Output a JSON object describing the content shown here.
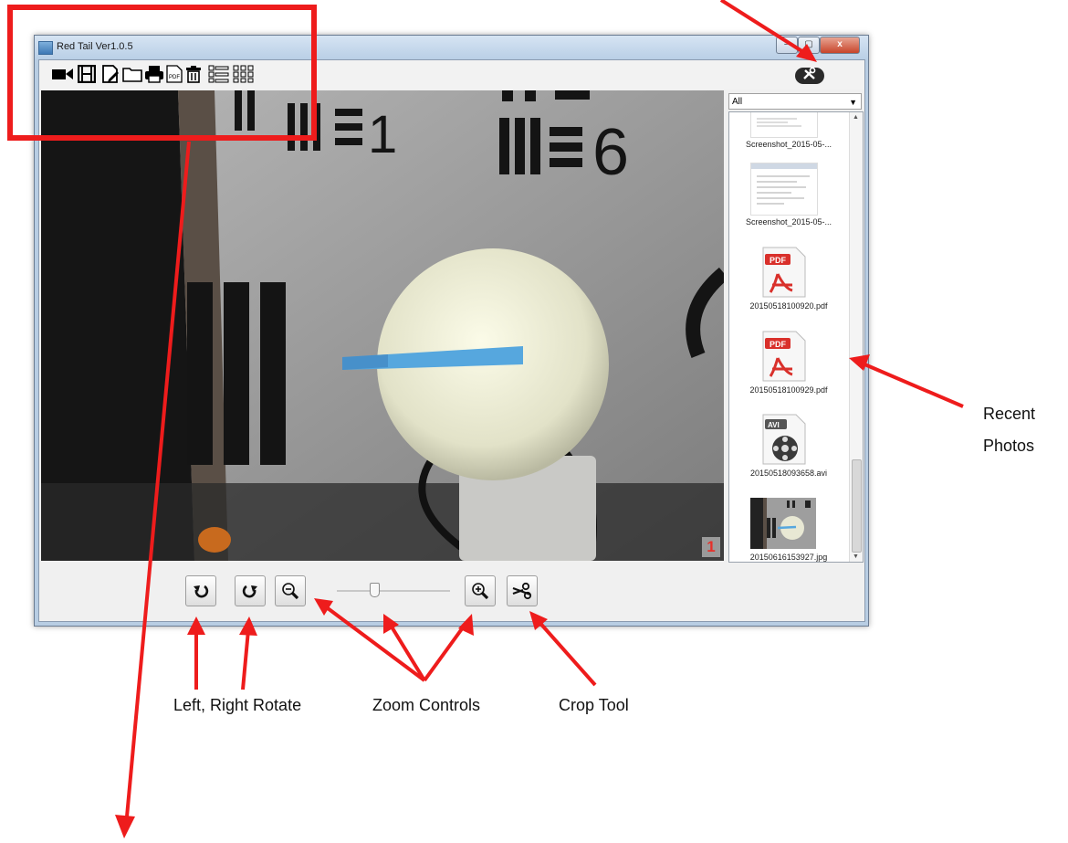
{
  "window": {
    "title": "Red Tail Ver1.0.5",
    "buttons": [
      "–",
      "▢",
      "x"
    ]
  },
  "toolbar": {
    "icons": [
      "video-camera-icon",
      "film-icon",
      "edit-document-icon",
      "folder-icon",
      "print-icon",
      "pdf-icon",
      "trash-icon",
      "list-view-icon",
      "grid-view-icon"
    ],
    "pdf_label": "PDF"
  },
  "settings": {
    "icon": "tools-icon"
  },
  "preview": {
    "frame_number": "1",
    "chart_numbers": [
      "1",
      "6"
    ]
  },
  "gallery": {
    "filter": "All",
    "items": [
      {
        "name": "Screenshot_2015-05-...",
        "type": "screenshot"
      },
      {
        "name": "Screenshot_2015-05-...",
        "type": "screenshot"
      },
      {
        "name": "20150518100920.pdf",
        "type": "pdf",
        "badge": "PDF"
      },
      {
        "name": "20150518100929.pdf",
        "type": "pdf",
        "badge": "PDF"
      },
      {
        "name": "20150518093658.avi",
        "type": "avi",
        "badge": "AVI"
      },
      {
        "name": "20150616153927.jpg",
        "type": "photo"
      }
    ]
  },
  "controls": {
    "slider_level": 0.33,
    "buttons": [
      "rotate-left-icon",
      "rotate-right-icon",
      "zoom-out-icon",
      "zoom-in-icon",
      "scissors-icon"
    ]
  },
  "annotations": {
    "recent": "Recent",
    "photos": "Photos",
    "rotate": "Left, Right Rotate",
    "zoom": "Zoom Controls",
    "crop": "Crop Tool"
  },
  "colors": {
    "highlight": "#ee1c1c",
    "pdf": "#d9302b"
  }
}
